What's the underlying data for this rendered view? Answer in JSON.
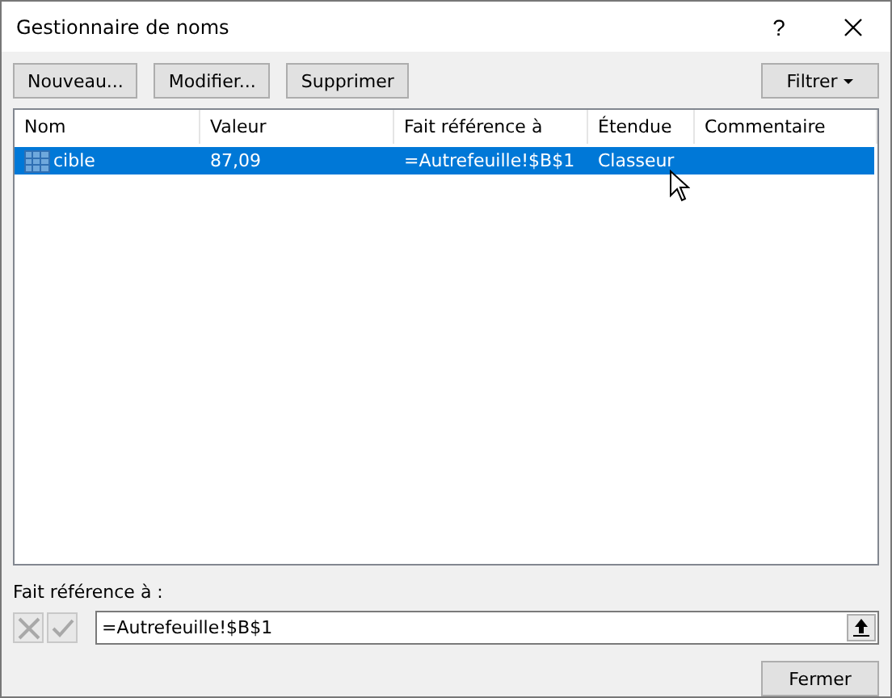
{
  "window": {
    "title": "Gestionnaire de noms",
    "help": "?"
  },
  "toolbar": {
    "buttons": [
      "Nouveau...",
      "Modifier...",
      "Supprimer"
    ],
    "filter": "Filtrer"
  },
  "table": {
    "columns": [
      "Nom",
      "Valeur",
      "Fait référence à",
      "Étendue",
      "Commentaire"
    ],
    "rows": [
      {
        "cells": [
          "cible",
          "87,09",
          "=Autrefeuille!$B$1",
          "Classeur",
          ""
        ],
        "selected": true
      }
    ]
  },
  "reference": {
    "label": "Fait référence à :",
    "value": "=Autrefeuille!$B$1",
    "cancel_disabled": true,
    "confirm_disabled": true
  },
  "buttons": [
    "Fermer"
  ]
}
